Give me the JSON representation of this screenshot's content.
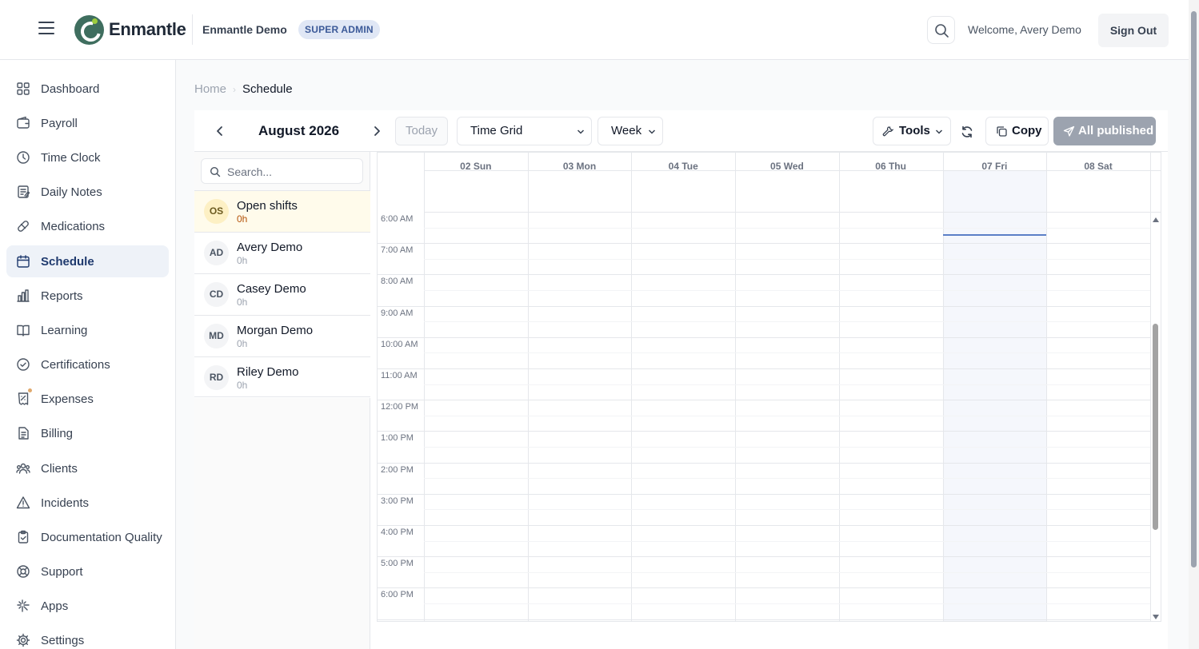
{
  "header": {
    "brand": "Enmantle",
    "org": "Enmantle Demo",
    "role_badge": "SUPER ADMIN",
    "welcome": "Welcome, Avery Demo",
    "sign_out": "Sign Out"
  },
  "sidebar": {
    "items": [
      {
        "label": "Dashboard",
        "icon": "grid-icon"
      },
      {
        "label": "Payroll",
        "icon": "wallet-icon"
      },
      {
        "label": "Time Clock",
        "icon": "clock-icon"
      },
      {
        "label": "Daily Notes",
        "icon": "notebook-icon"
      },
      {
        "label": "Medications",
        "icon": "pill-icon"
      },
      {
        "label": "Schedule",
        "icon": "calendar-icon",
        "active": true
      },
      {
        "label": "Reports",
        "icon": "bar-chart-icon"
      },
      {
        "label": "Learning",
        "icon": "book-icon"
      },
      {
        "label": "Certifications",
        "icon": "check-circle-icon"
      },
      {
        "label": "Expenses",
        "icon": "receipt-icon"
      },
      {
        "label": "Billing",
        "icon": "document-icon"
      },
      {
        "label": "Clients",
        "icon": "users-icon"
      },
      {
        "label": "Incidents",
        "icon": "warning-icon"
      },
      {
        "label": "Documentation Quality",
        "icon": "clipboard-check-icon"
      },
      {
        "label": "Support",
        "icon": "lifebuoy-icon"
      },
      {
        "label": "Apps",
        "icon": "sparkles-icon"
      },
      {
        "label": "Settings",
        "icon": "gear-icon"
      }
    ]
  },
  "breadcrumb": {
    "home": "Home",
    "current": "Schedule"
  },
  "toolbar": {
    "month": "August 2026",
    "today": "Today",
    "view_select": "Time Grid",
    "range_select": "Week",
    "tools": "Tools",
    "copy": "Copy",
    "publish": "All published"
  },
  "staff": {
    "search_placeholder": "Search...",
    "rows": [
      {
        "initials": "OS",
        "name": "Open shifts",
        "hours": "0h"
      },
      {
        "initials": "AD",
        "name": "Avery Demo",
        "hours": "0h"
      },
      {
        "initials": "CD",
        "name": "Casey Demo",
        "hours": "0h"
      },
      {
        "initials": "MD",
        "name": "Morgan Demo",
        "hours": "0h"
      },
      {
        "initials": "RD",
        "name": "Riley Demo",
        "hours": "0h"
      }
    ]
  },
  "calendar": {
    "days": [
      "02 Sun",
      "03 Mon",
      "04 Tue",
      "05 Wed",
      "06 Thu",
      "07 Fri",
      "08 Sat"
    ],
    "today_index": 5,
    "times": [
      "6:00 AM",
      "7:00 AM",
      "8:00 AM",
      "9:00 AM",
      "10:00 AM",
      "11:00 AM",
      "12:00 PM",
      "1:00 PM",
      "2:00 PM",
      "3:00 PM",
      "4:00 PM",
      "5:00 PM",
      "6:00 PM"
    ]
  }
}
